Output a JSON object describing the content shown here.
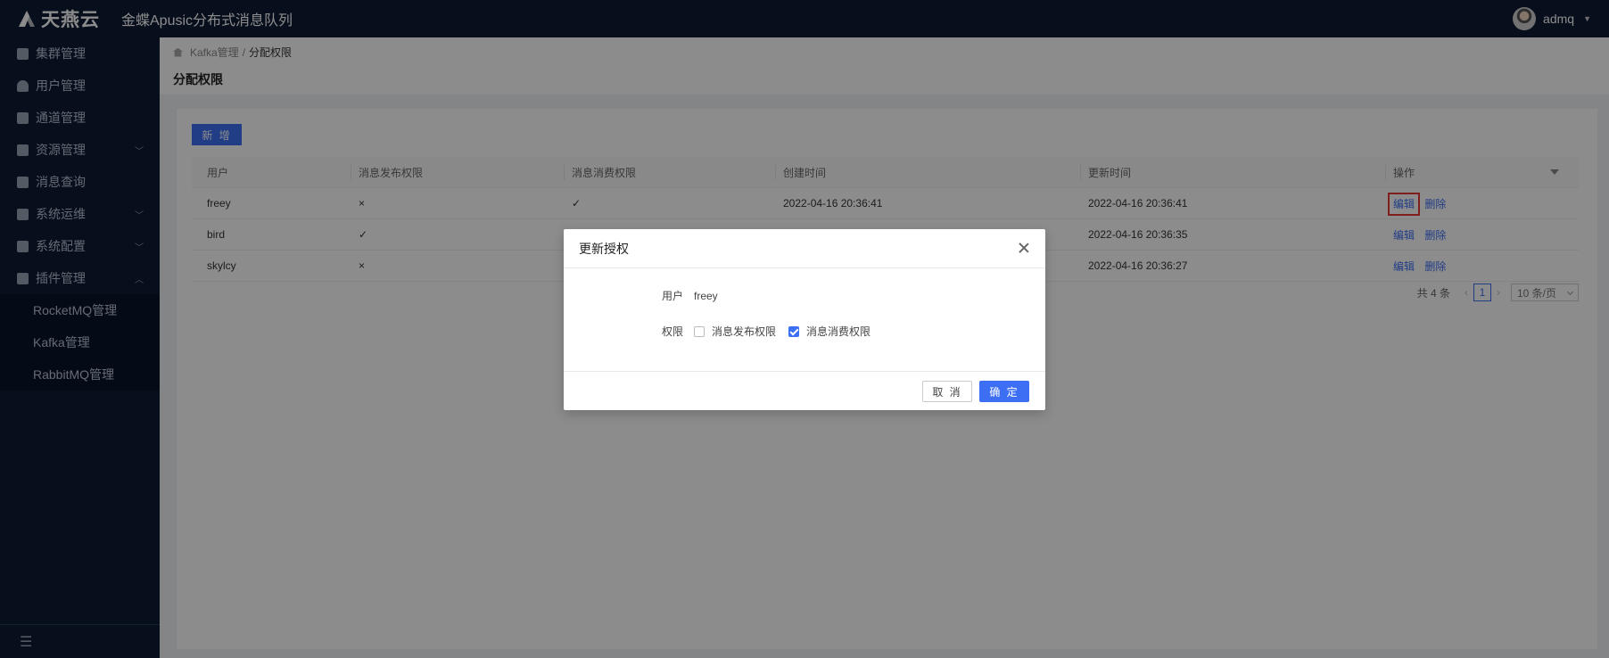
{
  "header": {
    "logo_text": "天燕云",
    "app_title": "金蝶Apusic分布式消息队列",
    "user_name": "admq"
  },
  "sidebar": {
    "items": [
      {
        "label": "集群管理",
        "icon": "cube-icon",
        "has_arrow": false
      },
      {
        "label": "用户管理",
        "icon": "user-icon",
        "has_arrow": false
      },
      {
        "label": "通道管理",
        "icon": "channel-icon",
        "has_arrow": false
      },
      {
        "label": "资源管理",
        "icon": "server-icon",
        "has_arrow": true
      },
      {
        "label": "消息查询",
        "icon": "document-search-icon",
        "has_arrow": false
      },
      {
        "label": "系统运维",
        "icon": "code-icon",
        "has_arrow": true
      },
      {
        "label": "系统配置",
        "icon": "settings-list-icon",
        "has_arrow": true
      },
      {
        "label": "插件管理",
        "icon": "puzzle-icon",
        "has_arrow": true,
        "expanded": true
      }
    ],
    "sub_items": [
      "RocketMQ管理",
      "Kafka管理",
      "RabbitMQ管理"
    ]
  },
  "breadcrumb": {
    "parent": "Kafka管理",
    "separator": "/",
    "current": "分配权限"
  },
  "page_title": "分配权限",
  "toolbar": {
    "add_label": "新 增"
  },
  "table": {
    "columns": [
      "用户",
      "消息发布权限",
      "消息消费权限",
      "创建时间",
      "更新时间",
      "操作"
    ],
    "rows": [
      {
        "user": "freey",
        "publish": "×",
        "consume": "✓",
        "created": "2022-04-16 20:36:41",
        "updated": "2022-04-16 20:36:41"
      },
      {
        "user": "bird",
        "publish": "✓",
        "consume": "",
        "created": "",
        "updated": "2022-04-16 20:36:35"
      },
      {
        "user": "skylcy",
        "publish": "×",
        "consume": "",
        "created": "",
        "updated": "2022-04-16 20:36:27"
      }
    ],
    "action_edit": "编辑",
    "action_delete": "删除"
  },
  "pagination": {
    "total_label": "共 4 条",
    "current_page": "1",
    "page_size": "10 条/页"
  },
  "modal": {
    "title": "更新授权",
    "user_label": "用户",
    "user_value": "freey",
    "perm_label": "权限",
    "perm_publish": "消息发布权限",
    "perm_consume": "消息消费权限",
    "perm_publish_checked": false,
    "perm_consume_checked": true,
    "cancel_label": "取 消",
    "ok_label": "确 定"
  },
  "colors": {
    "header_bg": "#0d1b33",
    "primary": "#3d6ff4",
    "highlight": "#e53935"
  }
}
